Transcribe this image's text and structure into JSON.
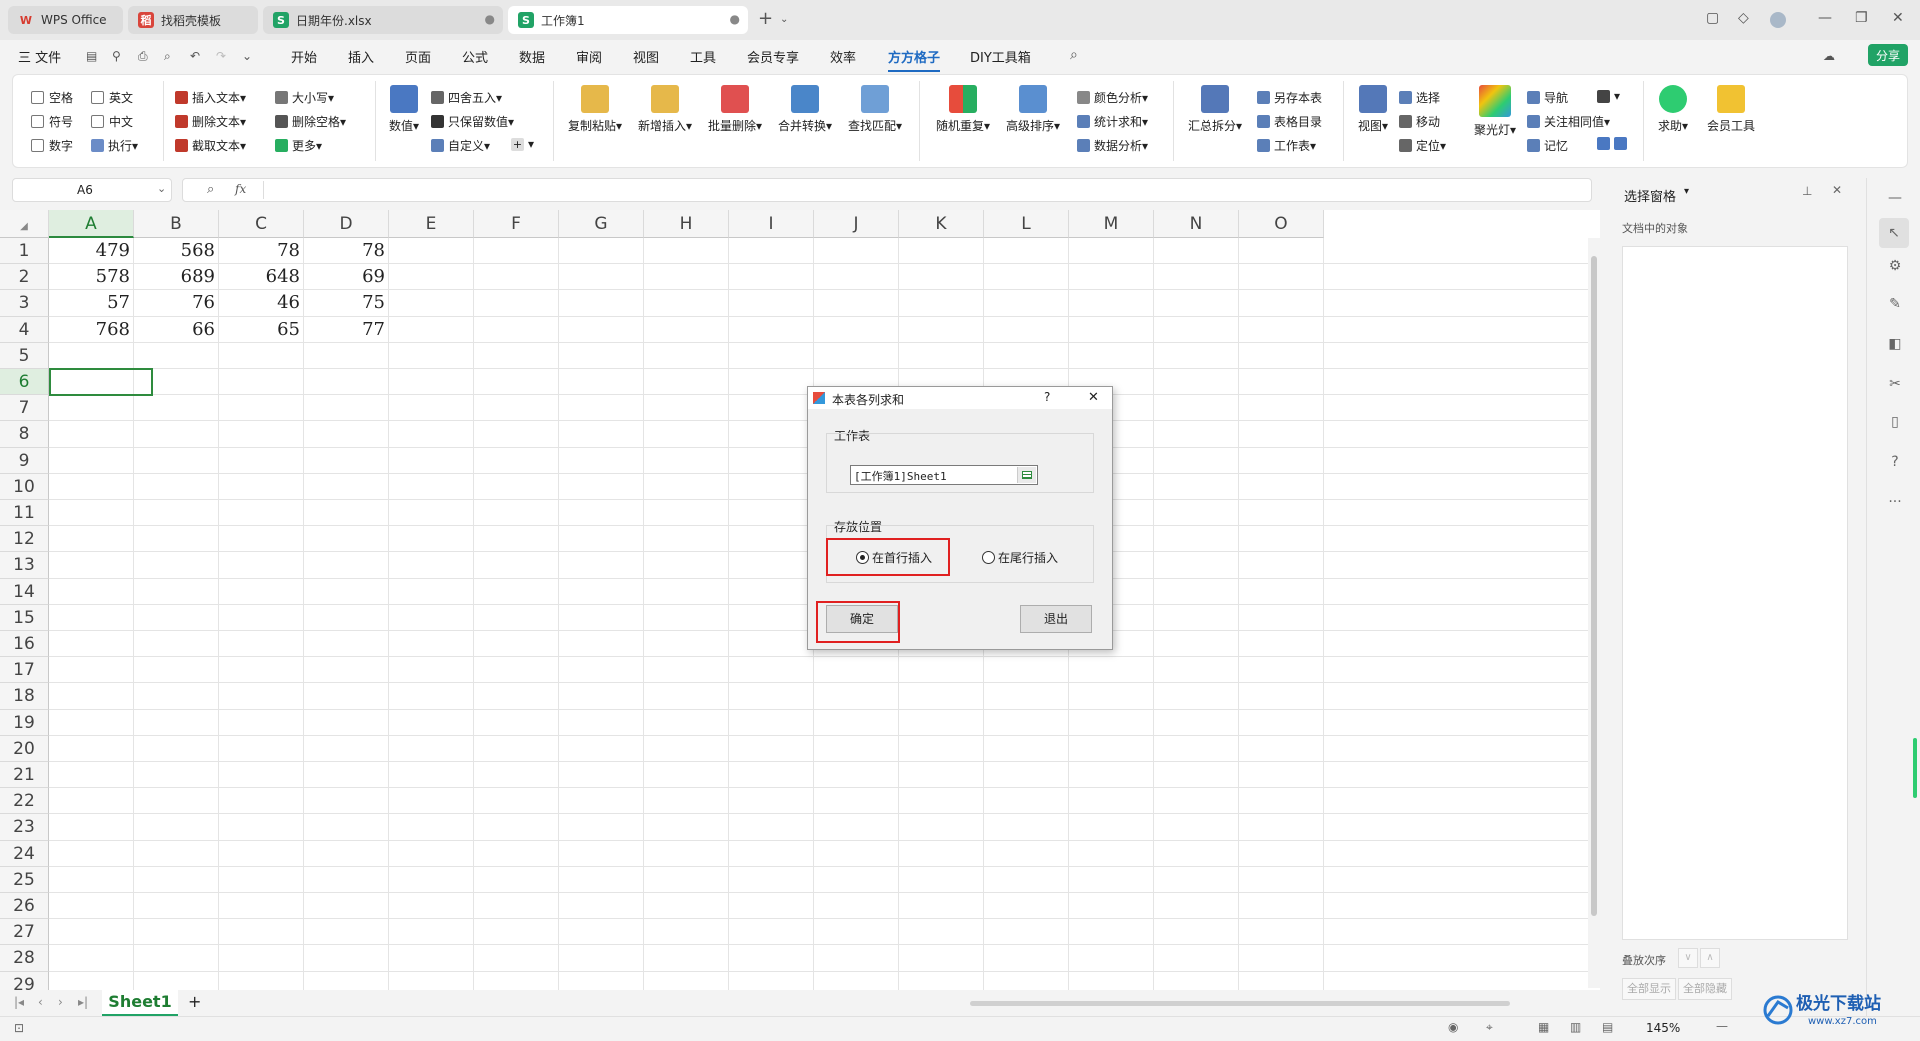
{
  "tabs": [
    {
      "label": "WPS Office",
      "icon": "wps-logo-icon",
      "color": "#d63b2f",
      "icon_char": "W"
    },
    {
      "label": "找稻壳模板",
      "icon": "docer-icon",
      "color": "#d9453b",
      "icon_char": "稻"
    },
    {
      "label": "日期年份.xlsx",
      "icon": "spreadsheet-icon",
      "color": "#21a366",
      "icon_char": "S"
    },
    {
      "label": "工作簿1",
      "icon": "spreadsheet-icon",
      "color": "#21a366",
      "icon_char": "S",
      "active": true
    }
  ],
  "menu": {
    "file": "三 文件",
    "items": [
      "开始",
      "插入",
      "页面",
      "公式",
      "数据",
      "审阅",
      "视图",
      "工具",
      "会员专享",
      "效率",
      "方方格子",
      "DIY工具箱"
    ],
    "active": "方方格子",
    "share": "分享"
  },
  "ribbon": {
    "checks": [
      [
        "空格",
        "英文"
      ],
      [
        "符号",
        "中文"
      ],
      [
        "数字",
        "执行"
      ]
    ],
    "text_ops": [
      "插入文本",
      "删除文本",
      "截取文本"
    ],
    "text_ops2": [
      "大小写",
      "删除空格",
      "更多"
    ],
    "numeric": "数值",
    "round_ops": [
      "四舍五入",
      "只保留数值",
      "自定义"
    ],
    "large": [
      {
        "id": "copy-paste",
        "label": "复制粘贴"
      },
      {
        "id": "add-insert",
        "label": "新增插入"
      },
      {
        "id": "batch-delete",
        "label": "批量删除"
      },
      {
        "id": "merge-convert",
        "label": "合并转换"
      },
      {
        "id": "find-match",
        "label": "查找匹配"
      },
      {
        "id": "random-repeat",
        "label": "随机重复"
      },
      {
        "id": "advanced-sort",
        "label": "高级排序"
      }
    ],
    "analysis": [
      "颜色分析",
      "统计求和",
      "数据分析"
    ],
    "summary_split": "汇总拆分",
    "save_ops": [
      "另存本表",
      "表格目录",
      "工作表"
    ],
    "view": "视图",
    "nav_ops": [
      "选择",
      "移动",
      "定位"
    ],
    "spotlight": "聚光灯",
    "nav2": [
      "导航",
      "关注相同值",
      "记忆"
    ],
    "help": "求助",
    "member": "会员工具"
  },
  "namebox": "A6",
  "fx": "fx",
  "columns": [
    "A",
    "B",
    "C",
    "D",
    "E",
    "F",
    "G",
    "H",
    "I",
    "J",
    "K",
    "L",
    "M",
    "N",
    "O"
  ],
  "rows": [
    "1",
    "2",
    "3",
    "4",
    "5",
    "6",
    "7",
    "8",
    "9",
    "10",
    "11",
    "12",
    "13",
    "14",
    "15",
    "16",
    "17",
    "18",
    "19",
    "20",
    "21",
    "22",
    "23",
    "24",
    "25",
    "26",
    "27",
    "28",
    "29"
  ],
  "cells": [
    [
      "479",
      "568",
      "78",
      "78"
    ],
    [
      "578",
      "689",
      "648",
      "69"
    ],
    [
      "57",
      "76",
      "46",
      "75"
    ],
    [
      "768",
      "66",
      "65",
      "77"
    ]
  ],
  "sheet": {
    "name": "Sheet1",
    "add": "+"
  },
  "pane": {
    "title": "选择窗格",
    "subtitle": "文档中的对象",
    "order_label": "叠放次序",
    "show_all": "全部显示",
    "hide_all": "全部隐藏"
  },
  "status": {
    "zoom": "145%"
  },
  "dialog": {
    "title": "本表各列求和",
    "help": "?",
    "close": "✕",
    "worksheet_label": "工作表",
    "worksheet_value": "[工作簿1]Sheet1",
    "position_label": "存放位置",
    "option_top": "在首行插入",
    "option_bottom": "在尾行插入",
    "selected": "top",
    "ok": "确定",
    "exit": "退出"
  },
  "watermark": "极光下载站",
  "watermark_url": "www.xz7.com"
}
